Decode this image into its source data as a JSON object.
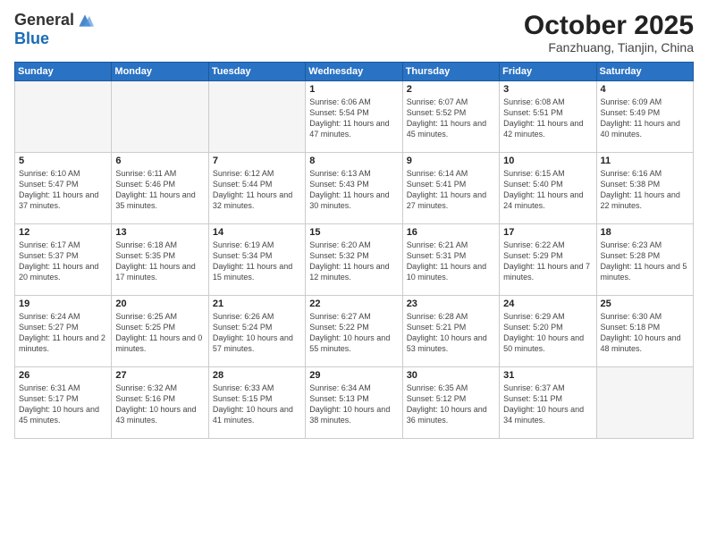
{
  "logo": {
    "general": "General",
    "blue": "Blue"
  },
  "title": "October 2025",
  "location": "Fanzhuang, Tianjin, China",
  "days_header": [
    "Sunday",
    "Monday",
    "Tuesday",
    "Wednesday",
    "Thursday",
    "Friday",
    "Saturday"
  ],
  "weeks": [
    [
      {
        "day": "",
        "info": ""
      },
      {
        "day": "",
        "info": ""
      },
      {
        "day": "",
        "info": ""
      },
      {
        "day": "1",
        "info": "Sunrise: 6:06 AM\nSunset: 5:54 PM\nDaylight: 11 hours and 47 minutes."
      },
      {
        "day": "2",
        "info": "Sunrise: 6:07 AM\nSunset: 5:52 PM\nDaylight: 11 hours and 45 minutes."
      },
      {
        "day": "3",
        "info": "Sunrise: 6:08 AM\nSunset: 5:51 PM\nDaylight: 11 hours and 42 minutes."
      },
      {
        "day": "4",
        "info": "Sunrise: 6:09 AM\nSunset: 5:49 PM\nDaylight: 11 hours and 40 minutes."
      }
    ],
    [
      {
        "day": "5",
        "info": "Sunrise: 6:10 AM\nSunset: 5:47 PM\nDaylight: 11 hours and 37 minutes."
      },
      {
        "day": "6",
        "info": "Sunrise: 6:11 AM\nSunset: 5:46 PM\nDaylight: 11 hours and 35 minutes."
      },
      {
        "day": "7",
        "info": "Sunrise: 6:12 AM\nSunset: 5:44 PM\nDaylight: 11 hours and 32 minutes."
      },
      {
        "day": "8",
        "info": "Sunrise: 6:13 AM\nSunset: 5:43 PM\nDaylight: 11 hours and 30 minutes."
      },
      {
        "day": "9",
        "info": "Sunrise: 6:14 AM\nSunset: 5:41 PM\nDaylight: 11 hours and 27 minutes."
      },
      {
        "day": "10",
        "info": "Sunrise: 6:15 AM\nSunset: 5:40 PM\nDaylight: 11 hours and 24 minutes."
      },
      {
        "day": "11",
        "info": "Sunrise: 6:16 AM\nSunset: 5:38 PM\nDaylight: 11 hours and 22 minutes."
      }
    ],
    [
      {
        "day": "12",
        "info": "Sunrise: 6:17 AM\nSunset: 5:37 PM\nDaylight: 11 hours and 20 minutes."
      },
      {
        "day": "13",
        "info": "Sunrise: 6:18 AM\nSunset: 5:35 PM\nDaylight: 11 hours and 17 minutes."
      },
      {
        "day": "14",
        "info": "Sunrise: 6:19 AM\nSunset: 5:34 PM\nDaylight: 11 hours and 15 minutes."
      },
      {
        "day": "15",
        "info": "Sunrise: 6:20 AM\nSunset: 5:32 PM\nDaylight: 11 hours and 12 minutes."
      },
      {
        "day": "16",
        "info": "Sunrise: 6:21 AM\nSunset: 5:31 PM\nDaylight: 11 hours and 10 minutes."
      },
      {
        "day": "17",
        "info": "Sunrise: 6:22 AM\nSunset: 5:29 PM\nDaylight: 11 hours and 7 minutes."
      },
      {
        "day": "18",
        "info": "Sunrise: 6:23 AM\nSunset: 5:28 PM\nDaylight: 11 hours and 5 minutes."
      }
    ],
    [
      {
        "day": "19",
        "info": "Sunrise: 6:24 AM\nSunset: 5:27 PM\nDaylight: 11 hours and 2 minutes."
      },
      {
        "day": "20",
        "info": "Sunrise: 6:25 AM\nSunset: 5:25 PM\nDaylight: 11 hours and 0 minutes."
      },
      {
        "day": "21",
        "info": "Sunrise: 6:26 AM\nSunset: 5:24 PM\nDaylight: 10 hours and 57 minutes."
      },
      {
        "day": "22",
        "info": "Sunrise: 6:27 AM\nSunset: 5:22 PM\nDaylight: 10 hours and 55 minutes."
      },
      {
        "day": "23",
        "info": "Sunrise: 6:28 AM\nSunset: 5:21 PM\nDaylight: 10 hours and 53 minutes."
      },
      {
        "day": "24",
        "info": "Sunrise: 6:29 AM\nSunset: 5:20 PM\nDaylight: 10 hours and 50 minutes."
      },
      {
        "day": "25",
        "info": "Sunrise: 6:30 AM\nSunset: 5:18 PM\nDaylight: 10 hours and 48 minutes."
      }
    ],
    [
      {
        "day": "26",
        "info": "Sunrise: 6:31 AM\nSunset: 5:17 PM\nDaylight: 10 hours and 45 minutes."
      },
      {
        "day": "27",
        "info": "Sunrise: 6:32 AM\nSunset: 5:16 PM\nDaylight: 10 hours and 43 minutes."
      },
      {
        "day": "28",
        "info": "Sunrise: 6:33 AM\nSunset: 5:15 PM\nDaylight: 10 hours and 41 minutes."
      },
      {
        "day": "29",
        "info": "Sunrise: 6:34 AM\nSunset: 5:13 PM\nDaylight: 10 hours and 38 minutes."
      },
      {
        "day": "30",
        "info": "Sunrise: 6:35 AM\nSunset: 5:12 PM\nDaylight: 10 hours and 36 minutes."
      },
      {
        "day": "31",
        "info": "Sunrise: 6:37 AM\nSunset: 5:11 PM\nDaylight: 10 hours and 34 minutes."
      },
      {
        "day": "",
        "info": ""
      }
    ]
  ]
}
